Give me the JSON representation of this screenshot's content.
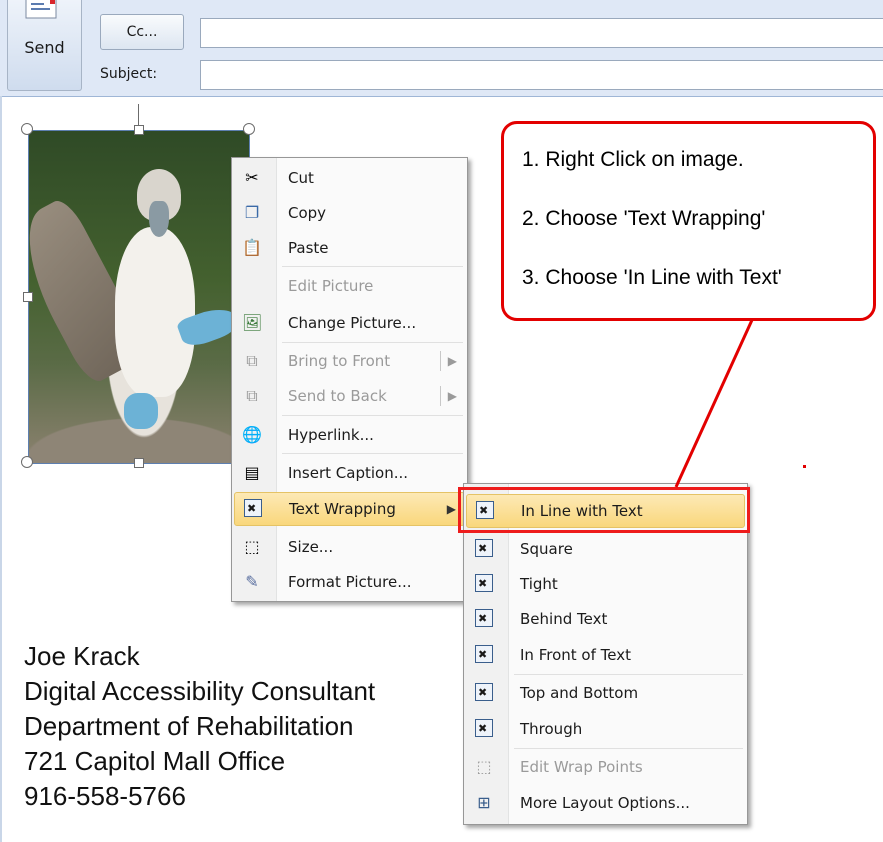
{
  "header": {
    "send_label": "Send",
    "cc_label": "Cc...",
    "cc_value": "",
    "subject_label": "Subject:",
    "subject_value": ""
  },
  "context_menu": {
    "items": [
      {
        "label": "Cut",
        "icon": "scissors-icon",
        "enabled": true
      },
      {
        "label": "Copy",
        "icon": "copy-icon",
        "enabled": true
      },
      {
        "label": "Paste",
        "icon": "paste-icon",
        "enabled": true
      },
      {
        "label": "Edit Picture",
        "icon": "",
        "enabled": false
      },
      {
        "label": "Change Picture...",
        "icon": "change-picture-icon",
        "enabled": true
      },
      {
        "label": "Bring to Front",
        "icon": "bring-to-front-icon",
        "enabled": false
      },
      {
        "label": "Send to Back",
        "icon": "send-to-back-icon",
        "enabled": false
      },
      {
        "label": "Hyperlink...",
        "icon": "hyperlink-icon",
        "enabled": true
      },
      {
        "label": "Insert Caption...",
        "icon": "caption-icon",
        "enabled": true
      },
      {
        "label": "Text Wrapping",
        "icon": "text-wrapping-icon",
        "enabled": true,
        "highlighted": true
      },
      {
        "label": "Size...",
        "icon": "size-icon",
        "enabled": true
      },
      {
        "label": "Format Picture...",
        "icon": "format-picture-icon",
        "enabled": true
      }
    ]
  },
  "wrap_submenu": {
    "items": [
      {
        "label": "In Line with Text",
        "icon": "inline-wrap-icon",
        "enabled": true,
        "highlighted": true
      },
      {
        "label": "Square",
        "icon": "square-wrap-icon",
        "enabled": true
      },
      {
        "label": "Tight",
        "icon": "tight-wrap-icon",
        "enabled": true
      },
      {
        "label": "Behind Text",
        "icon": "behind-text-icon",
        "enabled": true
      },
      {
        "label": "In Front of Text",
        "icon": "in-front-of-text-icon",
        "enabled": true
      },
      {
        "label": "Top and Bottom",
        "icon": "top-bottom-wrap-icon",
        "enabled": true
      },
      {
        "label": "Through",
        "icon": "through-wrap-icon",
        "enabled": true
      },
      {
        "label": "Edit Wrap Points",
        "icon": "edit-wrap-points-icon",
        "enabled": false
      },
      {
        "label": "More Layout Options...",
        "icon": "layout-options-icon",
        "enabled": true
      }
    ]
  },
  "callout": {
    "step1": "1. Right Click on image.",
    "step2": "2. Choose 'Text Wrapping'",
    "step3": "3. Choose 'In Line with Text'"
  },
  "signature": {
    "name": "Joe Krack",
    "title": "Digital Accessibility Consultant",
    "department": "Department of Rehabilitation",
    "address": "721 Capitol Mall Office",
    "phone": "916-558-5766"
  },
  "colors": {
    "annotation_red": "#e30000",
    "menu_highlight": "#f9d77c",
    "header_bg": "#dfe8f6"
  }
}
